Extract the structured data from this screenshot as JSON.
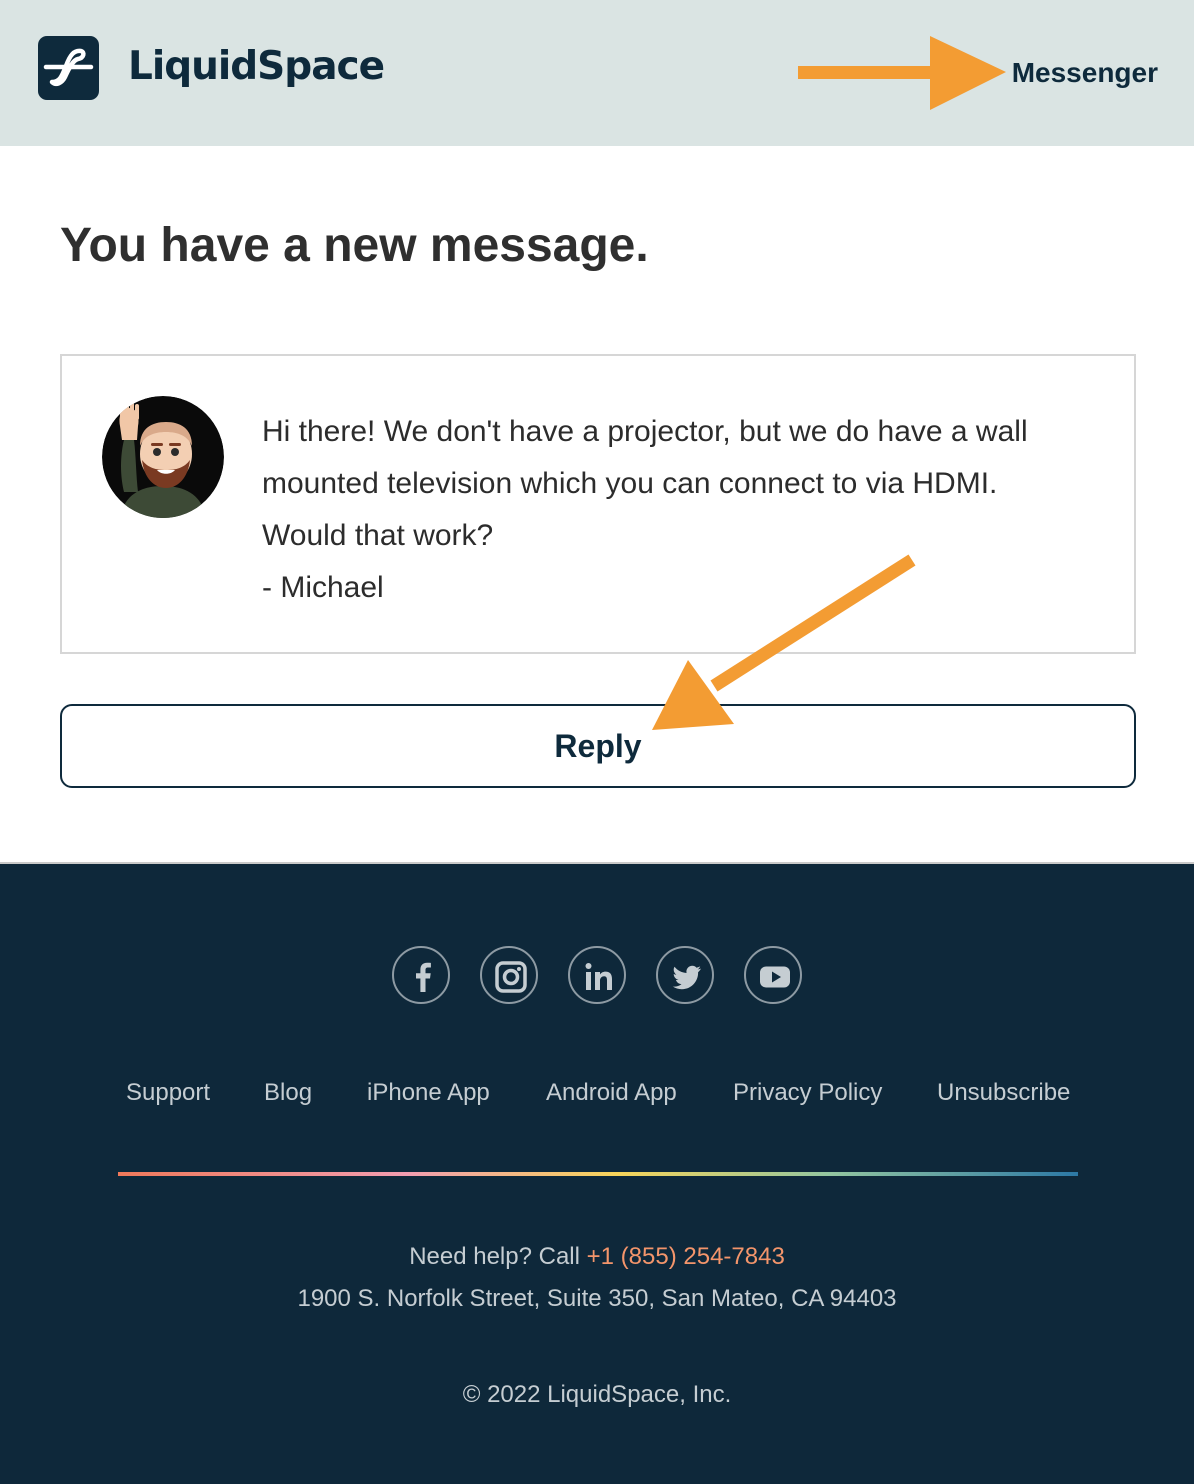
{
  "header": {
    "brand": "LiquidSpace",
    "link_label": "Messenger",
    "background": "#dae4e3",
    "annotation_arrow_color": "#f39c33"
  },
  "main": {
    "headline": "You have a new message.",
    "message": {
      "lines": [
        "Hi there! We don't have a projector, but we do have a wall mounted television which you can connect to via HDMI. Would that work?",
        "- Michael"
      ]
    },
    "reply_label": "Reply"
  },
  "footer": {
    "background": "#0e283a",
    "social_icons": [
      "facebook-icon",
      "instagram-icon",
      "linkedin-icon",
      "twitter-icon",
      "youtube-icon"
    ],
    "links": [
      "Support",
      "Blog",
      "iPhone App",
      "Android App",
      "Privacy Policy",
      "Unsubscribe"
    ],
    "help_prefix": "Need help? Call ",
    "phone": "+1 (855) 254-7843",
    "address": "1900 S. Norfolk Street, Suite 350, San Mateo, CA 94403",
    "copyright": "© 2022 LiquidSpace, Inc.",
    "phone_color": "#f3956b"
  }
}
